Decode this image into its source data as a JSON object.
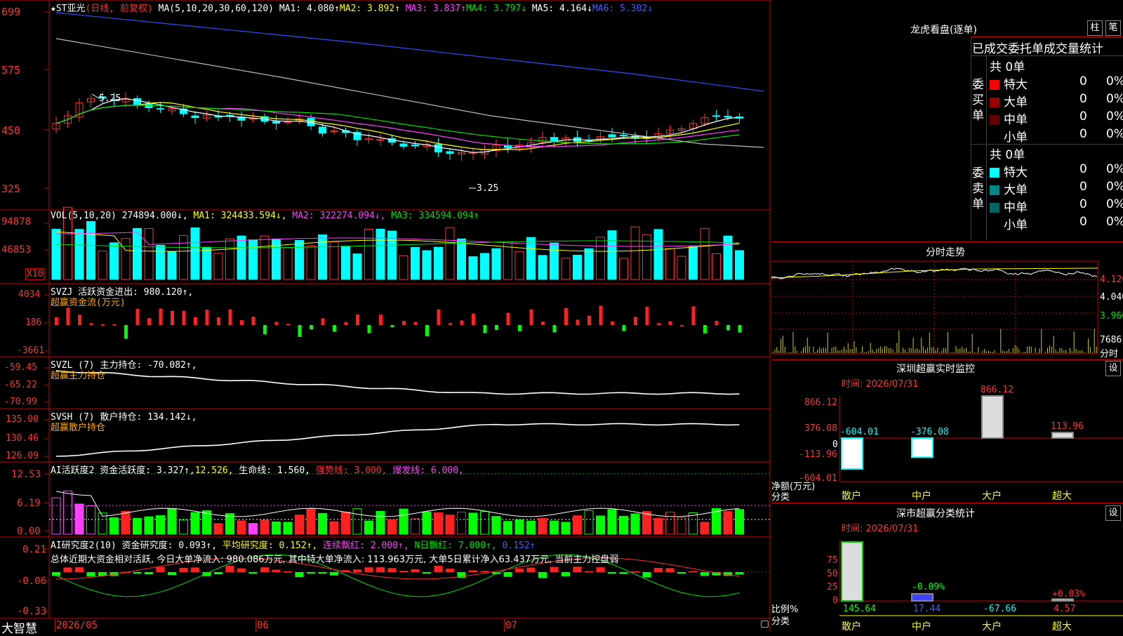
{
  "main": {
    "title_stock": "★ST亚光",
    "title_mode": "(日线, 前复权)",
    "ma_params": "MA(5,10,20,30,60,120)",
    "ma1": "MA1: 4.080↑",
    "ma2": "MA2: 3.892↑",
    "ma3": "MA3: 3.837↑",
    "ma4": "MA4: 3.797↓",
    "ma5": "MA5: 4.164↓",
    "ma6": "MA6: 5.302↓",
    "axis": [
      "699",
      "575",
      "450",
      "325"
    ],
    "marker_high": "5.25",
    "marker_low": "3.25"
  },
  "vol": {
    "header": "VOL(5,10,20) 274894.000↓,",
    "ma1": "MA1: 324433.594↓,",
    "ma2": "MA2: 322274.094↓,",
    "ma3": "MA3: 334594.094↑",
    "axis": [
      "94878",
      "46853",
      "X10"
    ]
  },
  "svzj": {
    "header": "SVZJ  活跃资金进出: 980.120↑,",
    "sub": "超赢资金流(万元)",
    "axis": [
      "4034",
      "186",
      "-3661"
    ]
  },
  "svzl": {
    "header": "SVZL (7) 主力持仓: -70.082↑,",
    "sub": "超赢主力持仓",
    "axis": [
      "-59.45",
      "-65.22",
      "-70.99"
    ]
  },
  "svsh": {
    "header": "SVSH (7) 散户持仓: 134.142↓,",
    "sub": "超赢散户持仓",
    "axis": [
      "135.00",
      "130.46",
      "126.09"
    ]
  },
  "ai1": {
    "header": "AI活跃度2 资金活跃度: 3.327↑,",
    "v2": "12.526,",
    "v3": "生命线: 1.560,",
    "v4": "强势线: 3.000,",
    "v5": "爆发线: 6.000,",
    "axis": [
      "12.53",
      "6.19",
      "0.00"
    ]
  },
  "ai2": {
    "header": "AI研究度2(10) 资金研究度: 0.093↑,",
    "v2": "平均研究度: 0.152↑,",
    "v3": "连续飘红: 2.000↑,",
    "v4": "N日飘红: 7.000↑,",
    "v5": "0.152↑",
    "summary": "总体近期大资金相对活跃, 今日大单净流入: 980.086万元, 其中特大单净流入: 113.963万元, 大单5日累计净入63.437万元, 当前主力控盘弱",
    "axis": [
      "0.21",
      "-0.06",
      "-0.33"
    ]
  },
  "bottom": {
    "brand": "大智慧",
    "dates": [
      "2026/05",
      "06",
      "07"
    ]
  },
  "lhb": {
    "title": "龙虎看盘(逐单)",
    "btn1": "柱",
    "btn2": "笔",
    "subtitle": "已成交委托单成交量统计",
    "buy_label": "委买单",
    "sell_label": "委卖单",
    "buy_total": "共 0单",
    "sell_total": "共 0单",
    "rows_buy": [
      {
        "name": "特大",
        "count": "0",
        "pct": "0%",
        "color": "#ff0000"
      },
      {
        "name": "大单",
        "count": "0",
        "pct": "0%",
        "color": "#990000"
      },
      {
        "name": "中单",
        "count": "0",
        "pct": "0%",
        "color": "#660000"
      },
      {
        "name": "小单",
        "count": "0",
        "pct": "0%",
        "color": "#000000"
      }
    ],
    "rows_sell": [
      {
        "name": "特大",
        "count": "0",
        "pct": "0%",
        "color": "#00ffff"
      },
      {
        "name": "大单",
        "count": "0",
        "pct": "0%",
        "color": "#008888"
      },
      {
        "name": "中单",
        "count": "0",
        "pct": "0%",
        "color": "#006666"
      },
      {
        "name": "小单",
        "count": "0",
        "pct": "0%",
        "color": "#000000"
      }
    ]
  },
  "intraday": {
    "title": "分时走势",
    "axis": [
      "4.120",
      "4.040",
      "3.960",
      "7686",
      "分时"
    ]
  },
  "monitor": {
    "title": "深圳超赢实时监控",
    "btn": "设",
    "time": "时间: 2026/07/31",
    "axis": [
      "866.12",
      "376.08",
      "0",
      "-113.96",
      "-604.01"
    ],
    "ylabel": "净额(万元)",
    "xlabel": "分类",
    "categories": [
      "散户",
      "中户",
      "大户",
      "超大"
    ],
    "values": [
      "-604.01",
      "-376.08",
      "866.12",
      "113.96"
    ]
  },
  "classify": {
    "title": "深市超赢分类统计",
    "btn": "设",
    "time": "时间: 2026/07/31",
    "axis": [
      "75",
      "50",
      "25",
      "0"
    ],
    "ylabel": "比例%",
    "xlabel": "分类",
    "categories": [
      "散户",
      "中户",
      "大户",
      "超大"
    ],
    "values": [
      "145.64",
      "17.44",
      "-67.66",
      "4.57"
    ],
    "top_labels": [
      "",
      "-0.09%",
      "",
      "+0.03%"
    ]
  }
}
